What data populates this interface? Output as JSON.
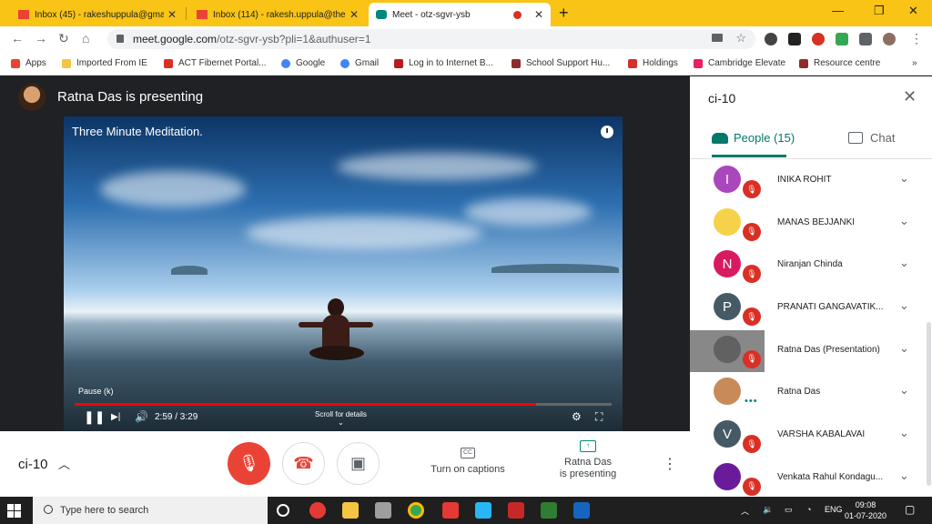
{
  "browser": {
    "tabs": [
      {
        "title": "Inbox (45) - rakeshuppula@gma"
      },
      {
        "title": "Inbox (114) - rakesh.uppula@the"
      },
      {
        "title": "Meet - otz-sgvr-ysb"
      }
    ],
    "new_tab": "+",
    "url_host": "meet.google.com",
    "url_path": "/otz-sgvr-ysb?pli=1&authuser=1",
    "bookmarks": [
      {
        "label": "Apps",
        "color": "#ea4335"
      },
      {
        "label": "Imported From IE",
        "color": "#f4c542"
      },
      {
        "label": "ACT Fibernet Portal...",
        "color": "#d93025"
      },
      {
        "label": "Google",
        "color": "#4285f4"
      },
      {
        "label": "Gmail",
        "color": "#4285f4"
      },
      {
        "label": "Log in to Internet B...",
        "color": "#b71c1c"
      },
      {
        "label": "School Support Hu...",
        "color": "#8d2b2b"
      },
      {
        "label": "Holdings",
        "color": "#d32f2f"
      },
      {
        "label": "Cambridge Elevate",
        "color": "#e91e63"
      },
      {
        "label": "Resource centre",
        "color": "#8d2b2b"
      }
    ],
    "more_bookmarks": "»"
  },
  "presenter": {
    "title": "Ratna Das is presenting"
  },
  "video": {
    "title": "Three Minute Meditation.",
    "pause_hint": "Pause (k)",
    "time": "2:59 / 3:29",
    "progress": 0.86,
    "scroll_hint": "Scroll for details"
  },
  "controls": {
    "meeting_name": "ci-10",
    "captions_label": "Turn on captions",
    "presenting_line1": "Ratna Das",
    "presenting_line2": "is presenting",
    "captions_icon_text": "CC"
  },
  "side_panel": {
    "title": "ci-10",
    "people_tab": "People (15)",
    "chat_tab": "Chat",
    "participants": [
      {
        "name": "INIKA ROHIT",
        "initial": "I",
        "color": "#ab47bc",
        "muted": true
      },
      {
        "name": "MANAS BEJJANKI",
        "initial": "",
        "color": "#f6d24a",
        "muted": true
      },
      {
        "name": "Niranjan Chinda",
        "initial": "N",
        "color": "#d81b60",
        "muted": true
      },
      {
        "name": "PRANATI GANGAVATIK...",
        "initial": "P",
        "color": "#455a64",
        "muted": true
      },
      {
        "name": "Ratna Das (Presentation)",
        "initial": "",
        "color": "#616161",
        "muted": true
      },
      {
        "name": "Ratna Das",
        "initial": "",
        "color": "#c98a5a",
        "muted": false
      },
      {
        "name": "VARSHA KABALAVAI",
        "initial": "V",
        "color": "#455a64",
        "muted": true
      },
      {
        "name": "Venkata Rahul Kondagu...",
        "initial": "",
        "color": "#6a1b9a",
        "muted": true
      }
    ]
  },
  "taskbar": {
    "search_placeholder": "Type here to search",
    "lang": "ENG",
    "time": "09:08",
    "date": "01-07-2020"
  }
}
